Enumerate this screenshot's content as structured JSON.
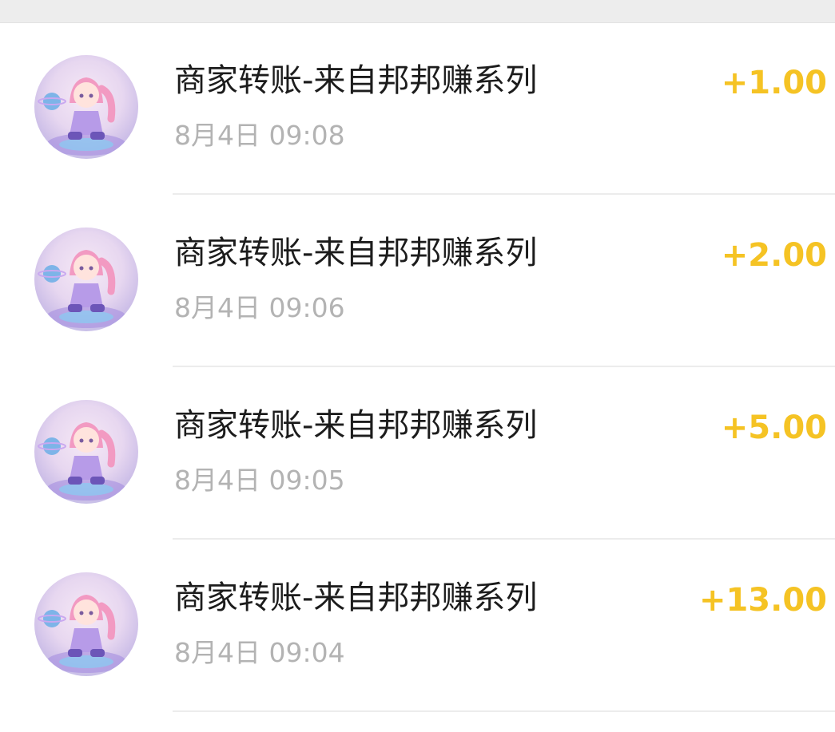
{
  "transactions": [
    {
      "title": "商家转账-来自邦邦赚系列",
      "time": "8月4日 09:08",
      "amount": "+1.00"
    },
    {
      "title": "商家转账-来自邦邦赚系列",
      "time": "8月4日 09:06",
      "amount": "+2.00"
    },
    {
      "title": "商家转账-来自邦邦赚系列",
      "time": "8月4日 09:05",
      "amount": "+5.00"
    },
    {
      "title": "商家转账-来自邦邦赚系列",
      "time": "8月4日 09:04",
      "amount": "+13.00"
    }
  ],
  "colors": {
    "amount": "#f5c324",
    "title": "#1c1c1c",
    "time": "#b3b3b3",
    "background": "#ffffff"
  },
  "icons": {
    "avatar": "anime-girl-astronaut-avatar"
  }
}
